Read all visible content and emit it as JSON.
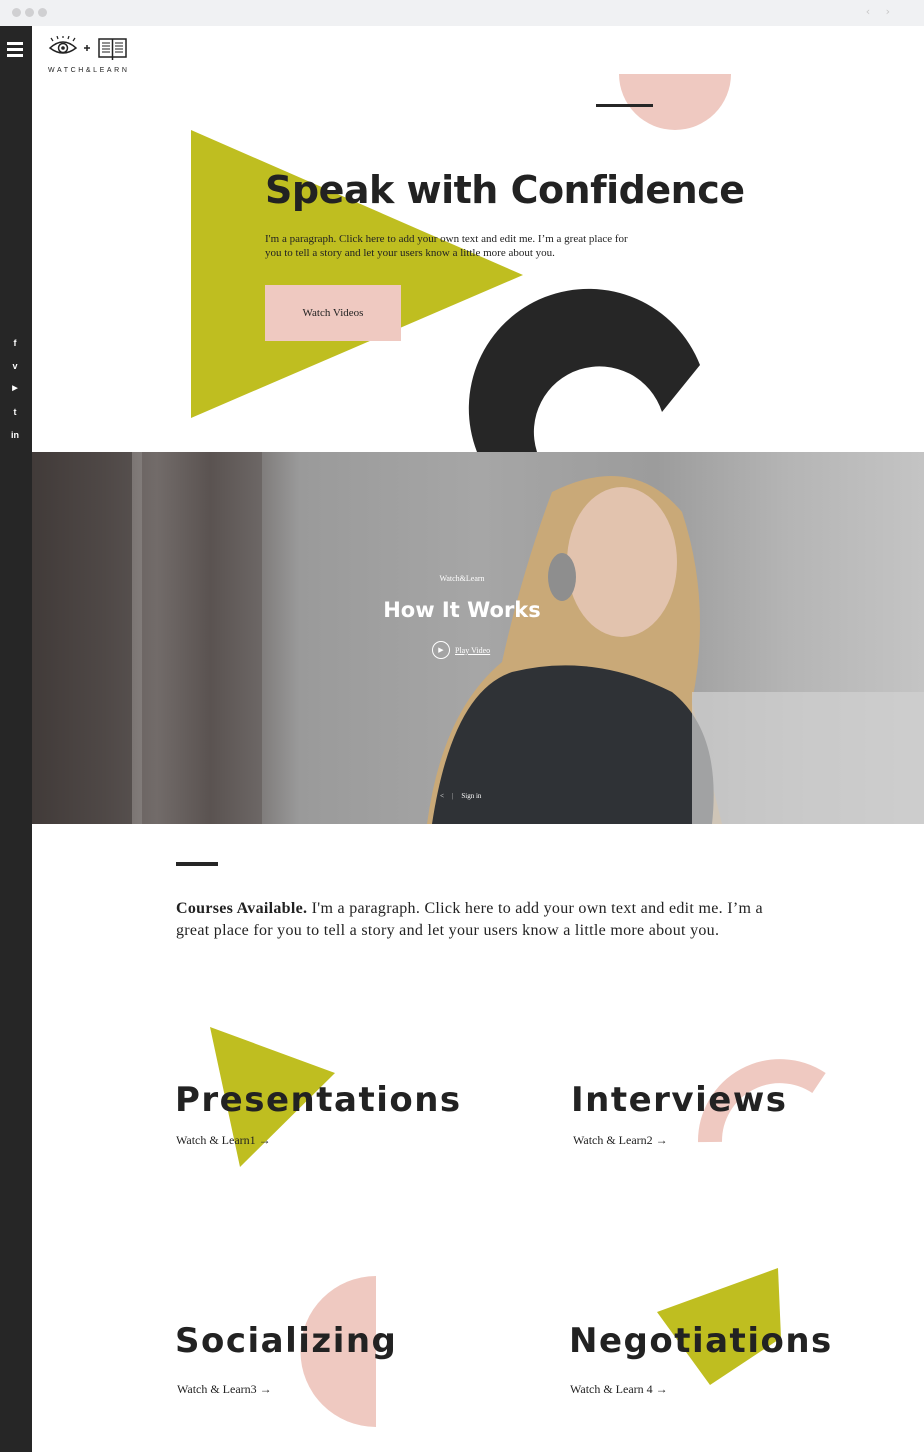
{
  "brand": {
    "name": "WATCH&LEARN"
  },
  "colors": {
    "accent_green": "#bfbe20",
    "accent_pink": "#efc9c1",
    "dark": "#262626"
  },
  "social": [
    {
      "icon": "facebook-icon",
      "glyph": "f"
    },
    {
      "icon": "vimeo-icon",
      "glyph": "v"
    },
    {
      "icon": "youtube-icon",
      "glyph": "▶"
    },
    {
      "icon": "twitter-icon",
      "glyph": "t"
    },
    {
      "icon": "linkedin-icon",
      "glyph": "in"
    }
  ],
  "hero": {
    "title": "Speak with Confidence",
    "paragraph": "I'm a paragraph. Click here to add your own text and edit me. I’m a great place for you to tell a story and let your users know a little more about you.",
    "button": "Watch Videos"
  },
  "video": {
    "kicker": "Watch&Learn",
    "title": "How It Works",
    "play": "Play Video",
    "signin": "Sign in"
  },
  "courses": {
    "lead": "Courses Available.",
    "text": " I'm a paragraph. Click here to add your own text and edit me. I’m a great place for you to tell a story and let your users know a little more about you."
  },
  "items": [
    {
      "title": "Presentations",
      "link": "Watch & Learn1 →"
    },
    {
      "title": "Interviews",
      "link": "Watch & Learn2 →"
    },
    {
      "title": "Socializing",
      "link": "Watch & Learn3 →"
    },
    {
      "title": "Negotiations",
      "link": "Watch & Learn 4 →"
    }
  ]
}
